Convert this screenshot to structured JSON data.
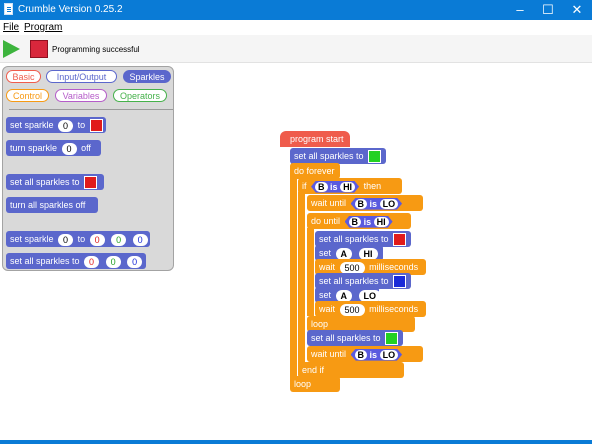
{
  "window": {
    "title": "Crumble Version 0.25.2"
  },
  "menu": {
    "file": "File",
    "program": "Program"
  },
  "toolbar": {
    "status": "Programming successful"
  },
  "palette": {
    "categories": [
      "Basic",
      "Input/Output",
      "Sparkles",
      "Control",
      "Variables",
      "Operators"
    ],
    "blocks": {
      "b1": {
        "text": "set sparkle",
        "num": "0",
        "to": "to",
        "color": "#e11b1b"
      },
      "b2": {
        "text": "turn sparkle",
        "num": "0",
        "tail": "off"
      },
      "b3": {
        "text": "set all sparkles to",
        "color": "#e11b1b"
      },
      "b4": {
        "text": "turn all sparkles off"
      },
      "b5": {
        "text": "set sparkle",
        "num": "0",
        "to": "to",
        "r": "0",
        "g": "0",
        "b": "0"
      },
      "b6": {
        "text": "set all sparkles to",
        "r": "0",
        "g": "0",
        "b": "0"
      }
    }
  },
  "program": {
    "start": "program start",
    "set_all_green": {
      "text": "set all sparkles to",
      "color": "#22d122"
    },
    "do_forever": "do forever",
    "if_label": "if",
    "if_var": "B",
    "is": "is",
    "if_val": "HI",
    "then": "then",
    "wait_until": "wait until",
    "wait_var": "B",
    "wait_val": "LO",
    "do_until": "do until",
    "du_var": "B",
    "du_val": "HI",
    "set_all_red": {
      "text": "set all sparkles to",
      "color": "#e11b1b"
    },
    "set_label": "set",
    "set_a": "A",
    "set_hi": "HI",
    "wait": "wait",
    "ms_val": "500",
    "ms": "milliseconds",
    "set_all_blue": {
      "text": "set all sparkles to",
      "color": "#1a2bd8"
    },
    "set_lo": "LO",
    "loop": "loop",
    "set_all_green2": {
      "text": "set all sparkles to",
      "color": "#22d122"
    },
    "end_if": "end if"
  },
  "colors": {
    "titlebar": "#0a7bd6",
    "sparkles": "#5b67cc",
    "control": "#f79a13",
    "start": "#ef5c4c"
  }
}
